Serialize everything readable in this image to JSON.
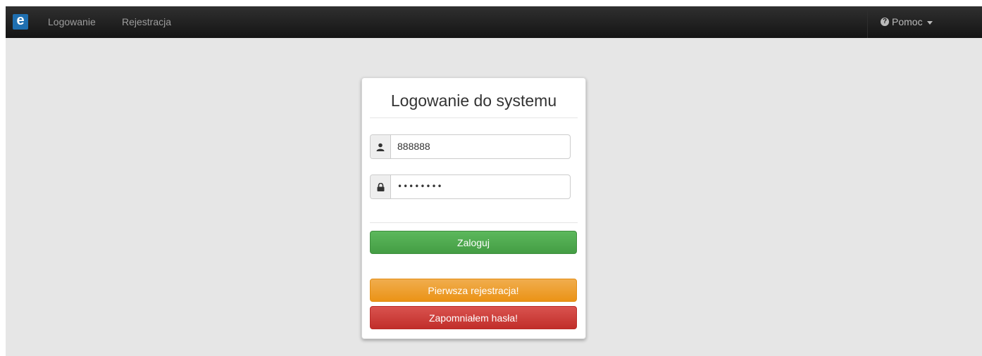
{
  "navbar": {
    "brand_letter": "e",
    "links": [
      "Logowanie",
      "Rejestracja"
    ],
    "help_label": "Pomoc",
    "help_icon": "question-circle-icon"
  },
  "login_form": {
    "title": "Logowanie do systemu",
    "username": {
      "value": "888888",
      "icon": "user-icon"
    },
    "password": {
      "masked_value": "••••••••",
      "icon": "lock-icon"
    },
    "login_button": "Zaloguj",
    "register_button": "Pierwsza rejestracja!",
    "forgot_button": "Zapomniałem hasła!"
  },
  "colors": {
    "navbar": "#222222",
    "brand": "#1f6fb0",
    "success": "#5cb85c",
    "warning": "#f0ad4e",
    "danger": "#d9534f",
    "background": "#e6e6e6"
  }
}
